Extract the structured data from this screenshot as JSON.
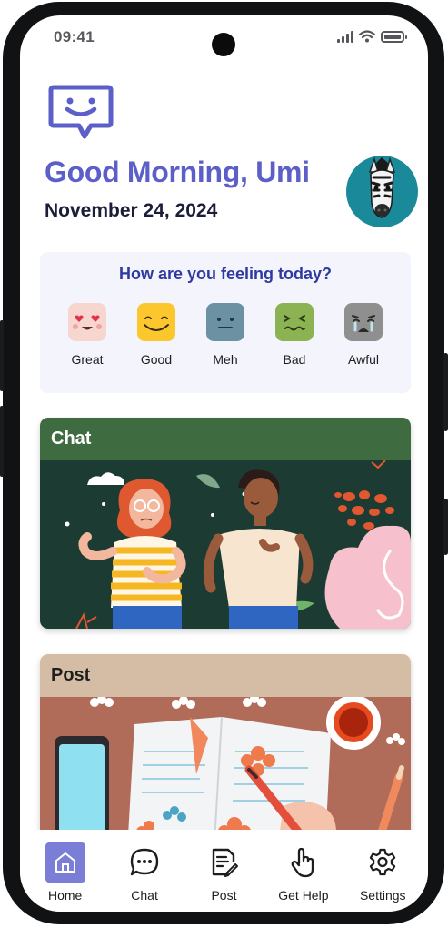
{
  "status_bar": {
    "time": "09:41"
  },
  "header": {
    "logo_icon": "chat-bubble-smile-icon",
    "greeting": "Good Morning, Umi",
    "date": "November 24, 2024",
    "avatar_icon": "zebra-avatar"
  },
  "mood": {
    "title": "How are you feeling today?",
    "options": [
      {
        "label": "Great",
        "icon": "heart-eyes-face-icon",
        "color": "#f7d6cf"
      },
      {
        "label": "Good",
        "icon": "smiling-face-icon",
        "color": "#fcc72c"
      },
      {
        "label": "Meh",
        "icon": "neutral-face-icon",
        "color": "#6b91a3"
      },
      {
        "label": "Bad",
        "icon": "sick-face-icon",
        "color": "#8cb352"
      },
      {
        "label": "Awful",
        "icon": "crying-face-icon",
        "color": "#8f8f8f"
      }
    ]
  },
  "cards": {
    "chat": {
      "title": "Chat"
    },
    "post": {
      "title": "Post"
    }
  },
  "nav": {
    "items": [
      {
        "label": "Home",
        "icon": "home-icon",
        "active": true
      },
      {
        "label": "Chat",
        "icon": "chat-icon",
        "active": false
      },
      {
        "label": "Post",
        "icon": "post-icon",
        "active": false
      },
      {
        "label": "Get Help",
        "icon": "hand-icon",
        "active": false
      },
      {
        "label": "Settings",
        "icon": "gear-icon",
        "active": false
      }
    ]
  },
  "colors": {
    "brand": "#5b5fc7",
    "mood_title": "#2f3aa0",
    "chat_header": "#3e6b3f",
    "post_header": "#d5bca4",
    "nav_active": "#7a7ed6"
  }
}
